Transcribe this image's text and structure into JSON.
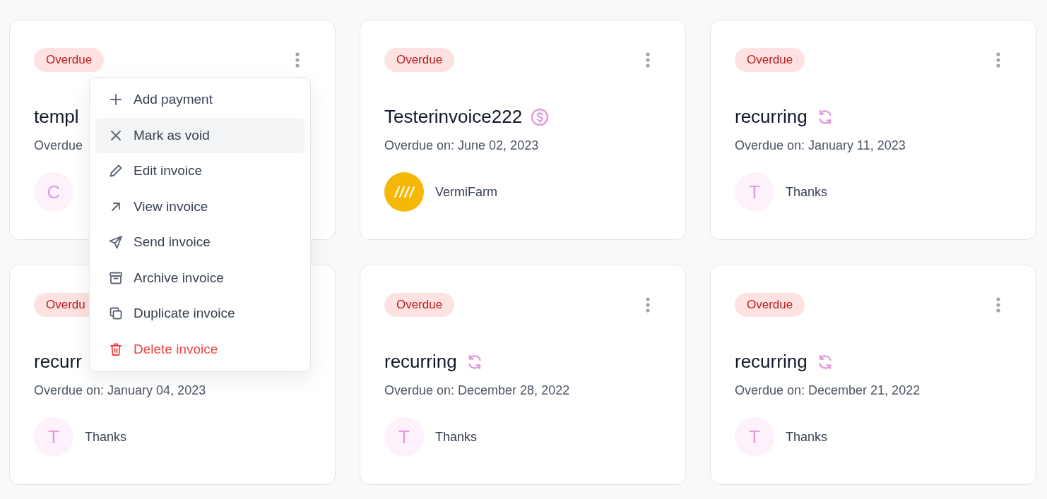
{
  "cards": [
    {
      "kind": "plain",
      "more_button": true,
      "status": "Overdue",
      "title": "templ",
      "due": "Overdue",
      "avatar": {
        "kind": "letter",
        "text": "C"
      }
    },
    {
      "kind": "paid",
      "more_button": true,
      "status": "Overdue",
      "title": "Testerinvoice222",
      "due": "Overdue on: June 02, 2023",
      "avatar": {
        "kind": "logo"
      },
      "client": "VermiFarm"
    },
    {
      "kind": "recurring",
      "more_button": true,
      "status": "Overdue",
      "title": "recurring",
      "due": "Overdue on: January 11, 2023",
      "avatar": {
        "kind": "letter",
        "text": "T"
      },
      "client": "Thanks"
    },
    {
      "kind": "plain",
      "more_button": false,
      "status": "Overdu",
      "title": "recurr",
      "due": "Overdue on: January 04, 2023",
      "avatar": {
        "kind": "letter",
        "text": "T"
      },
      "client": "Thanks"
    },
    {
      "kind": "recurring",
      "more_button": true,
      "status": "Overdue",
      "title": "recurring",
      "due": "Overdue on: December 28, 2022",
      "avatar": {
        "kind": "letter",
        "text": "T"
      },
      "client": "Thanks"
    },
    {
      "kind": "recurring",
      "more_button": true,
      "status": "Overdue",
      "title": "recurring",
      "due": "Overdue on: December 21, 2022",
      "avatar": {
        "kind": "letter",
        "text": "T"
      },
      "client": "Thanks"
    }
  ],
  "menu": {
    "items": [
      {
        "label": "Add payment",
        "highlighted": false,
        "kind": "normal"
      },
      {
        "label": "Mark as void",
        "highlighted": true,
        "kind": "normal"
      },
      {
        "label": "Edit invoice",
        "highlighted": false,
        "kind": "normal"
      },
      {
        "label": "View invoice",
        "highlighted": false,
        "kind": "normal"
      },
      {
        "label": "Send invoice",
        "highlighted": false,
        "kind": "normal"
      },
      {
        "label": "Archive invoice",
        "highlighted": false,
        "kind": "normal"
      },
      {
        "label": "Duplicate invoice",
        "highlighted": false,
        "kind": "normal"
      },
      {
        "label": "Delete invoice",
        "highlighted": false,
        "kind": "danger"
      }
    ]
  }
}
